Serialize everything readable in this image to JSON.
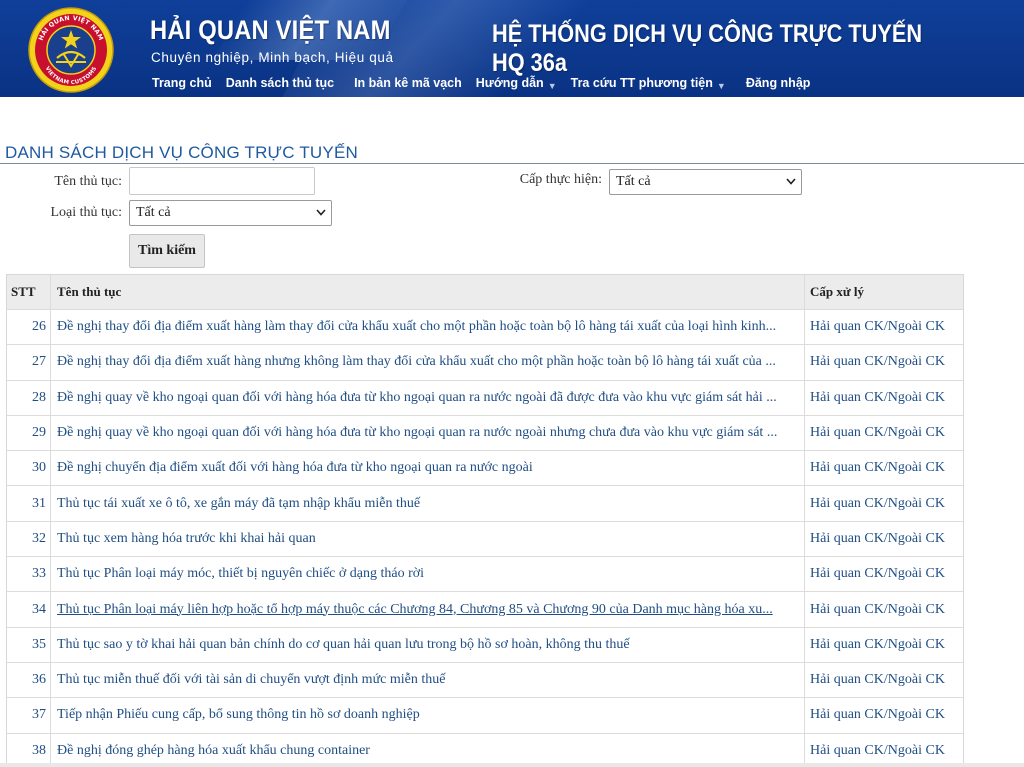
{
  "header": {
    "brand_title": "HẢI QUAN VIỆT NAM",
    "brand_slogan": "Chuyên nghiệp, Minh bạch, Hiệu quả",
    "system_title": "HỆ THỐNG DỊCH VỤ CÔNG TRỰC TUYẾN HQ 36a",
    "logo_icon": "vietnam-customs-emblem",
    "logo_text_top": "HẢI QUAN VIỆT NAM",
    "logo_text_bottom": "VIETNAM CUSTOMS",
    "colors": {
      "banner": "#0d3a90",
      "accent_link": "#1f4e84",
      "title": "#1f5a9e"
    }
  },
  "nav": {
    "items": [
      {
        "label": "Trang chủ",
        "has_dropdown": false
      },
      {
        "label": "Danh sách thủ tục",
        "has_dropdown": false
      },
      {
        "label": "In bản kê mã vạch",
        "has_dropdown": false
      },
      {
        "label": "Hướng dẫn",
        "has_dropdown": true
      },
      {
        "label": "Tra cứu TT phương tiện",
        "has_dropdown": true
      },
      {
        "label": "Đăng nhập",
        "has_dropdown": false
      }
    ]
  },
  "page": {
    "title": "DANH SÁCH DỊCH VỤ CÔNG TRỰC TUYẾN"
  },
  "filters": {
    "procedure_name_label": "Tên thủ tục:",
    "procedure_name_value": "",
    "level_label": "Cấp thực hiện:",
    "level_value": "Tất cả",
    "type_label": "Loại thủ tục:",
    "type_value": "Tất cả",
    "search_button": "Tìm kiếm"
  },
  "table": {
    "headers": {
      "stt": "STT",
      "name": "Tên thủ tục",
      "level": "Cấp xử lý"
    },
    "rows": [
      {
        "stt": "26",
        "name": "Đề nghị thay đổi địa điểm xuất hàng làm thay đổi cửa khẩu xuất cho một phần hoặc toàn bộ lô hàng tái xuất của loại hình kinh...",
        "level": "Hải quan CK/Ngoài CK"
      },
      {
        "stt": "27",
        "name": "Đề nghị thay đổi địa điểm xuất hàng nhưng không làm thay đổi cửa khẩu xuất cho một phần hoặc toàn bộ lô hàng tái xuất của ...",
        "level": "Hải quan CK/Ngoài CK"
      },
      {
        "stt": "28",
        "name": "Đề nghị quay về kho ngoại quan đối với hàng hóa đưa từ kho ngoại quan ra nước ngoài đã được đưa vào khu vực giám sát hải ...",
        "level": "Hải quan CK/Ngoài CK"
      },
      {
        "stt": "29",
        "name": "Đề nghị quay về kho ngoại quan đối với hàng hóa đưa từ kho ngoại quan ra nước ngoài nhưng chưa đưa vào khu vực giám sát ...",
        "level": "Hải quan CK/Ngoài CK"
      },
      {
        "stt": "30",
        "name": "Đề nghị chuyển địa điểm xuất đối với hàng hóa đưa từ kho ngoại quan ra nước ngoài",
        "level": "Hải quan CK/Ngoài CK"
      },
      {
        "stt": "31",
        "name": "Thủ tục tái xuất xe ô tô, xe gắn máy đã tạm nhập khẩu miễn thuế",
        "level": "Hải quan CK/Ngoài CK"
      },
      {
        "stt": "32",
        "name": "Thủ tục xem hàng hóa trước khi khai hải quan",
        "level": "Hải quan CK/Ngoài CK"
      },
      {
        "stt": "33",
        "name": "Thủ tục Phân loại máy móc, thiết bị nguyên chiếc ở dạng tháo rời",
        "level": "Hải quan CK/Ngoài CK"
      },
      {
        "stt": "34",
        "name": "Thủ tục Phân loại máy liên hợp hoặc tổ hợp máy thuộc các Chương 84, Chương 85 và Chương 90 của Danh mục hàng hóa xu...",
        "level": "Hải quan CK/Ngoài CK"
      },
      {
        "stt": "35",
        "name": "Thủ tục sao y tờ khai hải quan bản chính do cơ quan hải quan lưu trong bộ hồ sơ hoàn, không thu thuế",
        "level": "Hải quan CK/Ngoài CK"
      },
      {
        "stt": "36",
        "name": "Thủ tục miễn thuế đối với tài sản di chuyển vượt định mức miễn thuế",
        "level": "Hải quan CK/Ngoài CK"
      },
      {
        "stt": "37",
        "name": "Tiếp nhận Phiếu cung cấp, bổ sung thông tin hồ sơ doanh nghiệp",
        "level": "Hải quan CK/Ngoài CK"
      },
      {
        "stt": "38",
        "name": "Đề nghị đóng ghép hàng hóa xuất khẩu chung container",
        "level": "Hải quan CK/Ngoài CK"
      }
    ]
  }
}
